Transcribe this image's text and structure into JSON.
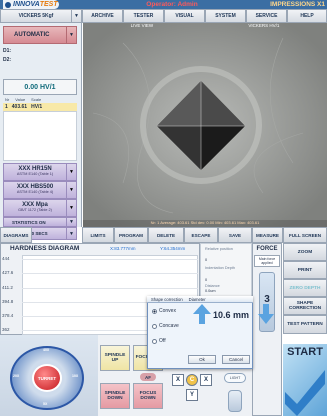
{
  "header": {
    "logo_a": "INNOVA",
    "logo_b": "TEST",
    "operator": "Operator: Admin",
    "company": "IMPRESSIONS X1"
  },
  "menu": {
    "method": "VICKERS 5Kgf",
    "items": [
      "ARCHIVE",
      "TESTER",
      "VISUAL",
      "SYSTEM",
      "SERVICE",
      "HELP"
    ]
  },
  "left_panel": {
    "mode": "AUTOMATIC",
    "d1_label": "D1:",
    "d2_label": "D2:",
    "hardness": "0.00 HV/1",
    "table_headers": [
      "Nr",
      "Value",
      "Scale"
    ],
    "first_row": {
      "nr": "1",
      "value": "403.61",
      "scale": "HV/1"
    },
    "conversions": [
      {
        "name": "XXX HR15N",
        "std": "ASTM E140 (Table 1)"
      },
      {
        "name": "XXX HBS500",
        "std": "ASTM E140 (Table 4)"
      },
      {
        "name": "XXX Mpa",
        "std": "GB/T 1172 (Table 2)"
      }
    ],
    "statistics": "STATISTICS ON",
    "dwell": "DWELL 10 SECS"
  },
  "live_view": {
    "label": "LIVE VIEW",
    "method": "VICKERS HV/1",
    "measurement": "Nr: 1   Average: 403.61   Std dev: 0.00   Min: 403.61   Max: 403.61"
  },
  "tabs": [
    "DIAGRAMS",
    "LIMITS",
    "PROGRAM",
    "DELETE",
    "ESCAPE",
    "SAVE",
    "MEASURE",
    "FULL SCREEN"
  ],
  "diagram": {
    "title": "HARDNESS DIAGRAM",
    "x_readout": "X:83.777mm",
    "y_readout": "Y:64.354mm",
    "ticks": [
      "444",
      "427.6",
      "411.2",
      "394.8",
      "378.4",
      "362"
    ]
  },
  "info": {
    "labels": [
      "Relative position",
      "Indentation Depth",
      "Distance",
      "Adjustment"
    ],
    "values": [
      "0",
      "0",
      "0.0um",
      "0.0um"
    ]
  },
  "force": {
    "title": "FORCE",
    "main_force": "Main force applied",
    "value": "3"
  },
  "right_buttons": [
    "ZOOM",
    "PRINT",
    "ZERO DEPTH",
    "SHAPE CORRECTION",
    "TEST PATTERN"
  ],
  "controls": {
    "turret": "TURRET",
    "spindle_up": "SPINDLE UP",
    "spindle_down": "SPINDLE DOWN",
    "focus_up": "FOCUS UP",
    "focus_down": "FOCUS DOWN",
    "af": "AF",
    "x_left": "X",
    "x_right": "X",
    "y": "Y",
    "c": "C",
    "light": "LIGHT",
    "start": "START",
    "turret_positions": [
      "40X",
      "10X",
      "5X",
      "20X"
    ]
  },
  "dialog": {
    "shape_title": "Shape correction",
    "diam_title": "Diameter",
    "options": [
      "Convex",
      "Concave",
      "Off"
    ],
    "selected": "Convex",
    "diameter": "10.6 mm",
    "ok": "Ok",
    "cancel": "Cancel"
  }
}
